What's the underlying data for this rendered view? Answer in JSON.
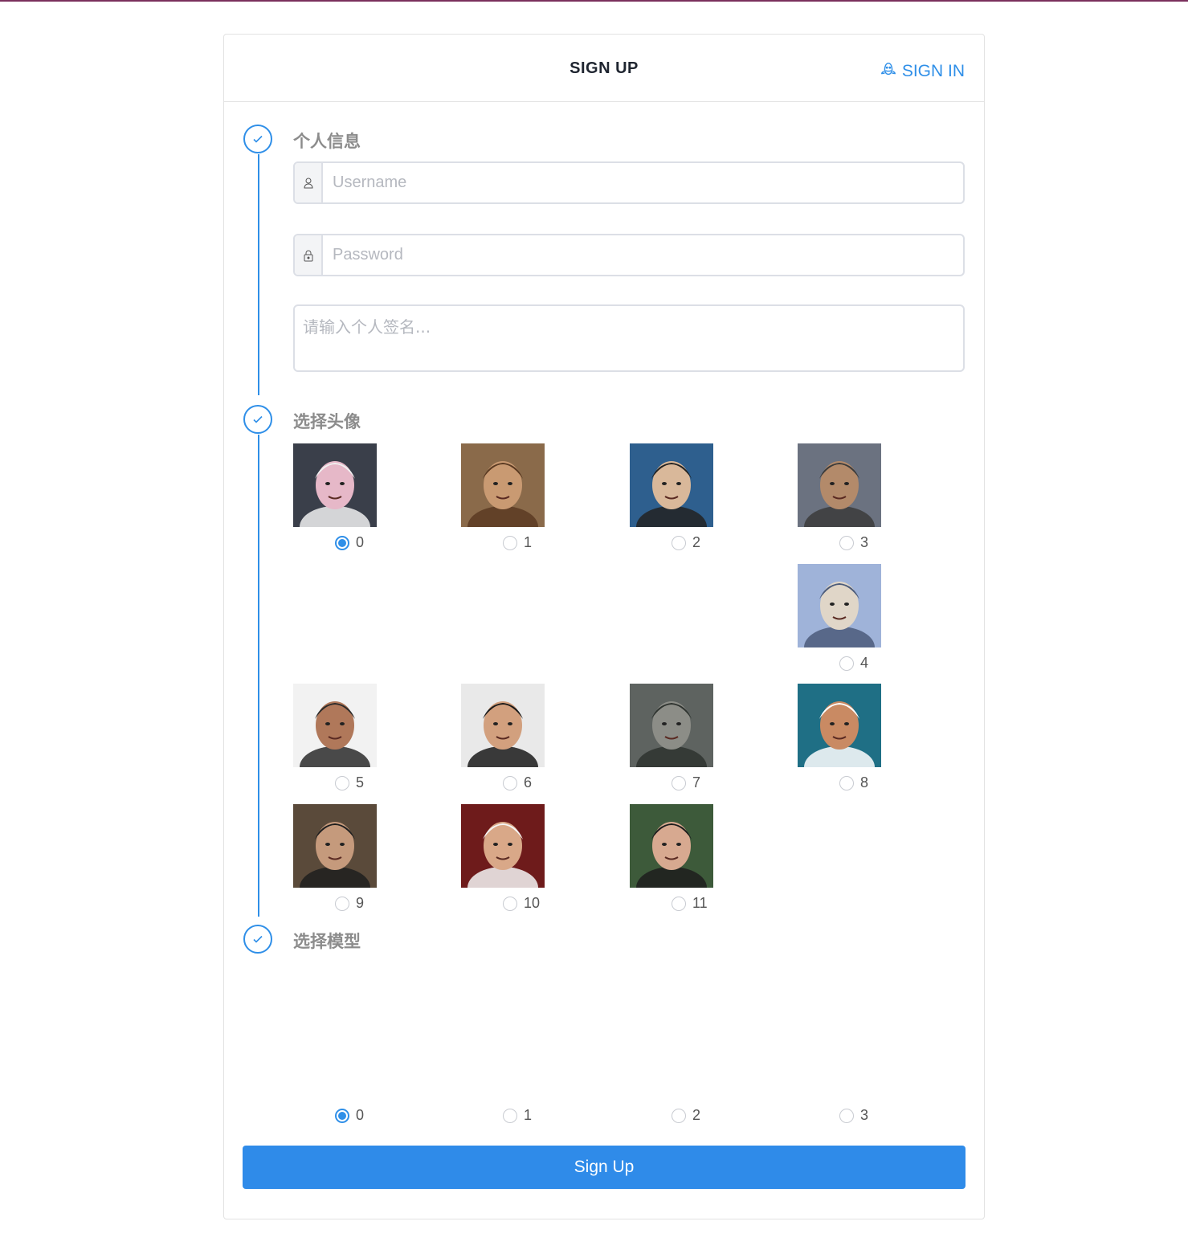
{
  "header": {
    "title": "SIGN UP",
    "signin_label": "SIGN IN",
    "signin_icon": "ghost-icon"
  },
  "steps": [
    {
      "title": "个人信息",
      "status": "done"
    },
    {
      "title": "选择头像",
      "status": "done"
    },
    {
      "title": "选择模型",
      "status": "done"
    }
  ],
  "form": {
    "username_placeholder": "Username",
    "username_icon": "user-icon",
    "password_placeholder": "Password",
    "password_icon": "lock-icon",
    "signature_placeholder": "请输入个人签名..."
  },
  "avatars": {
    "selected": "0",
    "options": [
      {
        "label": "0",
        "colors": [
          "#3a3f4a",
          "#e6b8c8",
          "#f0f0f0"
        ]
      },
      {
        "label": "1",
        "colors": [
          "#8a6a4a",
          "#c99a72",
          "#5a3a22"
        ]
      },
      {
        "label": "2",
        "colors": [
          "#2e5f8e",
          "#d9b89a",
          "#222222"
        ]
      },
      {
        "label": "3",
        "colors": [
          "#6b7280",
          "#b38a6a",
          "#3b3b3b"
        ]
      },
      {
        "label": "4",
        "colors": [
          "#9fb3d9",
          "#e0d6c8",
          "#4b5b7a"
        ]
      },
      {
        "label": "5",
        "colors": [
          "#f2f2f2",
          "#b0785a",
          "#2b2b2b"
        ]
      },
      {
        "label": "6",
        "colors": [
          "#e9e9e9",
          "#d2a07e",
          "#1a1a1a"
        ]
      },
      {
        "label": "7",
        "colors": [
          "#5e6360",
          "#8c8d87",
          "#2e332f"
        ]
      },
      {
        "label": "8",
        "colors": [
          "#1f6f85",
          "#c98a63",
          "#ffffff"
        ]
      },
      {
        "label": "9",
        "colors": [
          "#5a4a3a",
          "#c59a7c",
          "#1f1f1f"
        ]
      },
      {
        "label": "10",
        "colors": [
          "#6e1b1b",
          "#d9a888",
          "#f4f4f4"
        ]
      },
      {
        "label": "11",
        "colors": [
          "#3d5a3a",
          "#d7a990",
          "#1d1d1d"
        ]
      }
    ]
  },
  "models": {
    "selected": "0",
    "options": [
      "0",
      "1",
      "2",
      "3"
    ]
  },
  "submit_label": "Sign Up"
}
